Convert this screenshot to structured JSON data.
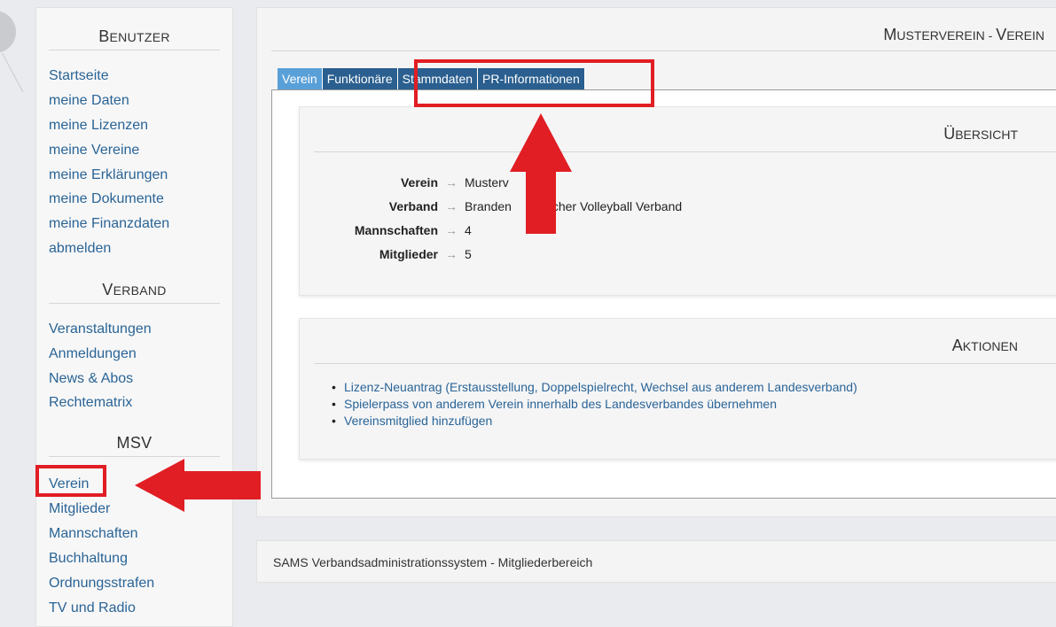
{
  "sidebar": {
    "sections": [
      {
        "title_first": "B",
        "title_rest": "ENUTZER",
        "items": [
          "Startseite",
          "meine Daten",
          "meine Lizenzen",
          "meine Vereine",
          "meine Erklärungen",
          "meine Dokumente",
          "meine Finanzdaten",
          "abmelden"
        ]
      },
      {
        "title_first": "V",
        "title_rest": "ERBAND",
        "items": [
          "Veranstaltungen",
          "Anmeldungen",
          "News & Abos",
          "Rechtematrix"
        ]
      },
      {
        "title_first": "MSV",
        "title_rest": "",
        "items": [
          "Verein",
          "Mitglieder",
          "Mannschaften",
          "Buchhaltung",
          "Ordnungsstrafen",
          "TV und Radio"
        ]
      }
    ]
  },
  "main": {
    "title_first_m": "M",
    "title_rest": "USTERVEREIN - ",
    "title_first_v": "V",
    "title_rest2": "EREIN",
    "tabs": [
      "Verein",
      "Funktionäre",
      "Stammdaten",
      "PR-Informationen"
    ],
    "uebersicht": {
      "title_first": "Ü",
      "title_rest": "BERSICHT",
      "rows": [
        {
          "label": "Verein",
          "value": "Musterv"
        },
        {
          "label": "Verband",
          "value": "Branden          scher Volleyball Verband"
        },
        {
          "label": "Mannschaften",
          "value": "4"
        },
        {
          "label": "Mitglieder",
          "value": "5"
        }
      ],
      "arrow": "→"
    },
    "aktionen": {
      "title_first": "A",
      "title_rest": "KTIONEN",
      "items": [
        "Lizenz-Neuantrag (Erstausstellung, Doppelspielrecht, Wechsel aus anderem Landesverband)",
        "Spielerpass von anderem Verein innerhalb des Landesverbandes übernehmen",
        "Vereinsmitglied hinzufügen"
      ]
    }
  },
  "footer": {
    "text": "SAMS Verbandsadministrationssystem - Mitgliederbereich"
  },
  "colors": {
    "annotation": "#e01e24",
    "tab_active": "#5aa0d8",
    "tab": "#2a5f8f",
    "link": "#2a6496"
  }
}
